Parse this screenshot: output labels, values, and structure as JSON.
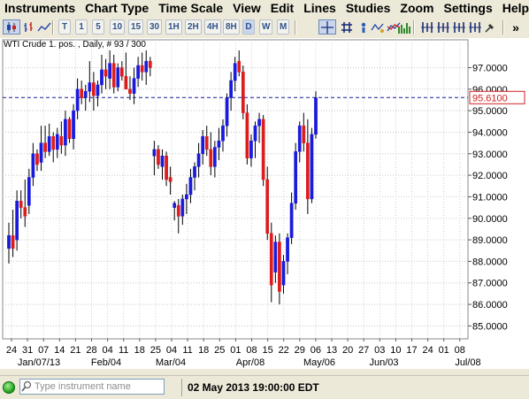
{
  "menu": [
    "Instruments",
    "Chart Type",
    "Time Scale",
    "View",
    "Edit",
    "Lines",
    "Studies",
    "Zoom",
    "Settings",
    "Help"
  ],
  "toolbar": {
    "timeframes": [
      "T",
      "1",
      "5",
      "10",
      "15",
      "30",
      "1H",
      "2H",
      "4H",
      "8H",
      "D",
      "W",
      "M"
    ],
    "active_timeframe": "D",
    "overflow": "»"
  },
  "chart": {
    "title": "WTI Crude 1. pos. , Daily, # 93 / 300",
    "current_price_label": "95.6100",
    "current_price": 95.61,
    "colors": {
      "up": "#1a1adc",
      "down": "#dd1c1c",
      "price_line": "#1c1c9c",
      "price_label": "#d02020"
    }
  },
  "chart_data": {
    "type": "candlestick",
    "ylim": [
      84.4,
      97.8
    ],
    "ytick_labels": [
      "85.0000",
      "86.0000",
      "87.0000",
      "88.0000",
      "89.0000",
      "90.0000",
      "91.0000",
      "92.0000",
      "93.0000",
      "94.0000",
      "95.0000",
      "96.0000",
      "97.0000"
    ],
    "ytick_values": [
      85,
      86,
      87,
      88,
      89,
      90,
      91,
      92,
      93,
      94,
      95,
      96,
      97
    ],
    "xtick_labels": [
      "24",
      "31",
      "07",
      "14",
      "21",
      "28",
      "04",
      "11",
      "18",
      "25",
      "04",
      "11",
      "18",
      "25",
      "01",
      "08",
      "15",
      "22",
      "29",
      "06",
      "13",
      "20",
      "27",
      "03",
      "10",
      "17",
      "24",
      "01",
      "08"
    ],
    "month_labels": [
      "Jan/07/13",
      "Feb/04",
      "Mar/04",
      "Apr/08",
      "May/06",
      "Jun/03",
      "Jul/08"
    ],
    "candles": [
      {
        "o": 88.6,
        "h": 89.8,
        "l": 87.9,
        "c": 89.2
      },
      {
        "o": 89.2,
        "h": 90.4,
        "l": 88.2,
        "c": 88.6
      },
      {
        "o": 89.0,
        "h": 91.3,
        "l": 88.5,
        "c": 90.8
      },
      {
        "o": 90.8,
        "h": 91.3,
        "l": 90.0,
        "c": 90.5
      },
      {
        "o": 90.5,
        "h": 91.8,
        "l": 89.6,
        "c": 90.1
      },
      {
        "o": 90.6,
        "h": 92.3,
        "l": 90.2,
        "c": 91.9
      },
      {
        "o": 91.9,
        "h": 93.5,
        "l": 91.5,
        "c": 93.0
      },
      {
        "o": 93.0,
        "h": 93.2,
        "l": 92.2,
        "c": 92.5
      },
      {
        "o": 92.6,
        "h": 94.3,
        "l": 92.2,
        "c": 93.5
      },
      {
        "o": 93.5,
        "h": 94.3,
        "l": 92.8,
        "c": 93.1
      },
      {
        "o": 93.1,
        "h": 94.4,
        "l": 92.9,
        "c": 93.8
      },
      {
        "o": 93.8,
        "h": 94.0,
        "l": 92.6,
        "c": 93.2
      },
      {
        "o": 93.2,
        "h": 94.2,
        "l": 92.8,
        "c": 93.9
      },
      {
        "o": 93.8,
        "h": 94.5,
        "l": 93.0,
        "c": 93.4
      },
      {
        "o": 93.4,
        "h": 95.0,
        "l": 92.9,
        "c": 94.6
      },
      {
        "o": 94.6,
        "h": 94.7,
        "l": 93.5,
        "c": 93.7
      },
      {
        "o": 93.7,
        "h": 95.3,
        "l": 93.2,
        "c": 95.0
      },
      {
        "o": 95.0,
        "h": 96.5,
        "l": 94.6,
        "c": 96.0
      },
      {
        "o": 96.0,
        "h": 96.4,
        "l": 95.3,
        "c": 95.6
      },
      {
        "o": 95.6,
        "h": 96.2,
        "l": 95.0,
        "c": 95.9
      },
      {
        "o": 95.9,
        "h": 97.3,
        "l": 95.4,
        "c": 96.3
      },
      {
        "o": 96.3,
        "h": 96.8,
        "l": 95.0,
        "c": 95.7
      },
      {
        "o": 95.7,
        "h": 96.4,
        "l": 95.2,
        "c": 96.2
      },
      {
        "o": 96.2,
        "h": 97.6,
        "l": 95.8,
        "c": 96.9
      },
      {
        "o": 96.9,
        "h": 97.4,
        "l": 96.0,
        "c": 96.6
      },
      {
        "o": 96.5,
        "h": 97.8,
        "l": 96.0,
        "c": 97.2
      },
      {
        "o": 97.2,
        "h": 97.6,
        "l": 95.8,
        "c": 96.1
      },
      {
        "o": 96.1,
        "h": 97.2,
        "l": 95.9,
        "c": 97.0
      },
      {
        "o": 97.0,
        "h": 97.3,
        "l": 96.4,
        "c": 96.6
      },
      {
        "o": 96.6,
        "h": 97.7,
        "l": 96.0,
        "c": 96.0
      },
      {
        "o": 96.0,
        "h": 96.6,
        "l": 95.5,
        "c": 95.8
      },
      {
        "o": 95.8,
        "h": 97.0,
        "l": 95.3,
        "c": 96.5
      },
      {
        "o": 96.5,
        "h": 97.5,
        "l": 96.1,
        "c": 97.1
      },
      {
        "o": 97.1,
        "h": 97.7,
        "l": 96.4,
        "c": 96.8
      },
      {
        "o": 96.8,
        "h": 97.8,
        "l": 96.2,
        "c": 97.3
      },
      {
        "o": 97.3,
        "h": 97.5,
        "l": 96.6,
        "c": 97.0
      },
      {
        "o": 92.9,
        "h": 93.6,
        "l": 92.0,
        "c": 93.2
      },
      {
        "o": 93.2,
        "h": 93.4,
        "l": 92.3,
        "c": 92.5
      },
      {
        "o": 92.4,
        "h": 93.2,
        "l": 91.8,
        "c": 92.9
      },
      {
        "o": 92.9,
        "h": 93.1,
        "l": 91.5,
        "c": 91.8
      },
      {
        "o": 91.9,
        "h": 92.4,
        "l": 91.1,
        "c": 91.7
      },
      {
        "o": 90.5,
        "h": 90.8,
        "l": 89.9,
        "c": 90.7
      },
      {
        "o": 90.6,
        "h": 90.9,
        "l": 89.3,
        "c": 90.1
      },
      {
        "o": 90.1,
        "h": 91.1,
        "l": 89.7,
        "c": 90.9
      },
      {
        "o": 90.9,
        "h": 91.6,
        "l": 90.2,
        "c": 91.1
      },
      {
        "o": 91.1,
        "h": 92.3,
        "l": 90.7,
        "c": 91.9
      },
      {
        "o": 91.9,
        "h": 92.6,
        "l": 91.3,
        "c": 92.4
      },
      {
        "o": 92.4,
        "h": 93.5,
        "l": 91.9,
        "c": 93.0
      },
      {
        "o": 93.0,
        "h": 94.1,
        "l": 92.5,
        "c": 93.8
      },
      {
        "o": 93.8,
        "h": 94.3,
        "l": 92.9,
        "c": 93.2
      },
      {
        "o": 93.2,
        "h": 94.0,
        "l": 92.0,
        "c": 92.4
      },
      {
        "o": 92.4,
        "h": 93.6,
        "l": 91.9,
        "c": 93.3
      },
      {
        "o": 93.3,
        "h": 94.2,
        "l": 92.7,
        "c": 93.6
      },
      {
        "o": 93.6,
        "h": 94.6,
        "l": 93.1,
        "c": 94.3
      },
      {
        "o": 94.3,
        "h": 95.8,
        "l": 93.8,
        "c": 95.6
      },
      {
        "o": 95.6,
        "h": 96.8,
        "l": 95.0,
        "c": 96.4
      },
      {
        "o": 96.4,
        "h": 97.5,
        "l": 95.9,
        "c": 97.2
      },
      {
        "o": 97.3,
        "h": 97.8,
        "l": 96.6,
        "c": 96.8
      },
      {
        "o": 96.8,
        "h": 97.1,
        "l": 94.6,
        "c": 94.9
      },
      {
        "o": 94.9,
        "h": 95.3,
        "l": 92.5,
        "c": 92.8
      },
      {
        "o": 92.8,
        "h": 93.9,
        "l": 92.4,
        "c": 93.6
      },
      {
        "o": 93.6,
        "h": 94.5,
        "l": 92.8,
        "c": 94.3
      },
      {
        "o": 94.3,
        "h": 94.9,
        "l": 93.5,
        "c": 94.6
      },
      {
        "o": 94.6,
        "h": 94.8,
        "l": 91.5,
        "c": 91.8
      },
      {
        "o": 91.8,
        "h": 92.4,
        "l": 89.0,
        "c": 89.3
      },
      {
        "o": 89.3,
        "h": 89.8,
        "l": 86.1,
        "c": 86.9
      },
      {
        "o": 87.5,
        "h": 89.2,
        "l": 87.0,
        "c": 88.9
      },
      {
        "o": 88.9,
        "h": 89.3,
        "l": 86.0,
        "c": 86.6
      },
      {
        "o": 86.9,
        "h": 88.3,
        "l": 86.5,
        "c": 88.0
      },
      {
        "o": 88.0,
        "h": 89.3,
        "l": 87.4,
        "c": 89.1
      },
      {
        "o": 89.1,
        "h": 91.2,
        "l": 88.8,
        "c": 90.7
      },
      {
        "o": 90.7,
        "h": 93.5,
        "l": 90.4,
        "c": 93.1
      },
      {
        "o": 93.1,
        "h": 94.5,
        "l": 92.6,
        "c": 94.3
      },
      {
        "o": 94.3,
        "h": 94.9,
        "l": 93.1,
        "c": 93.5
      },
      {
        "o": 93.5,
        "h": 94.6,
        "l": 90.2,
        "c": 90.9
      },
      {
        "o": 90.9,
        "h": 94.2,
        "l": 90.7,
        "c": 93.9
      },
      {
        "o": 93.9,
        "h": 95.9,
        "l": 93.7,
        "c": 95.6
      }
    ]
  },
  "statusbar": {
    "search_placeholder": "Type instrument name",
    "datetime": "02 May 2013 19:00:00 EDT"
  }
}
